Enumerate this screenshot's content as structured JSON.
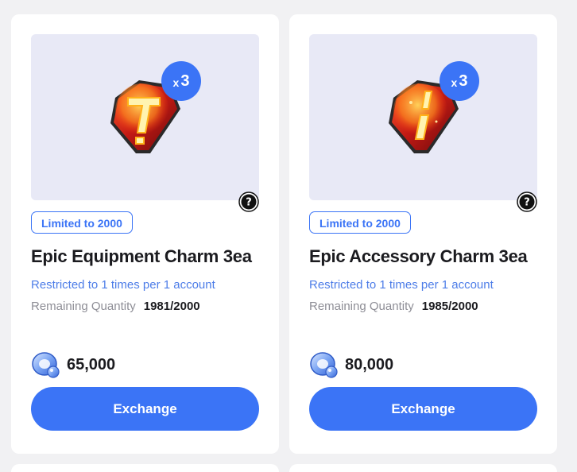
{
  "products": [
    {
      "icon": "epic-equipment-charm",
      "quantity_prefix": "x",
      "quantity_number": "3",
      "limit_badge": "Limited to 2000",
      "title": "Epic Equipment Charm 3ea",
      "restriction": "Restricted to 1 times per 1 account",
      "remaining_label": "Remaining Quantity",
      "remaining_value": "1981/2000",
      "currency_icon": "blue-gem-currency",
      "price": "65,000",
      "button_label": "Exchange"
    },
    {
      "icon": "epic-accessory-charm",
      "quantity_prefix": "x",
      "quantity_number": "3",
      "limit_badge": "Limited to 2000",
      "title": "Epic Accessory Charm 3ea",
      "restriction": "Restricted to 1 times per 1 account",
      "remaining_label": "Remaining Quantity",
      "remaining_value": "1985/2000",
      "currency_icon": "blue-gem-currency",
      "price": "80,000",
      "button_label": "Exchange"
    }
  ],
  "colors": {
    "accent": "#3b74f6",
    "restriction_text": "#4d7de8",
    "thumbnail_bg": "#e8e9f6",
    "page_bg": "#f1f1f3"
  }
}
